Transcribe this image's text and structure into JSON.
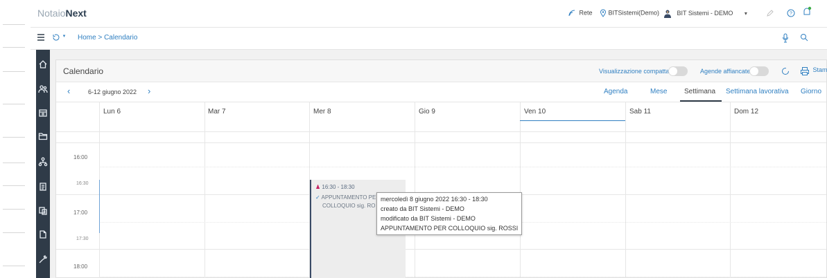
{
  "app": {
    "logo_prefix": "Notaio",
    "logo_suffix": "Next"
  },
  "topbar": {
    "network_label": "Rete",
    "location_label": "BITSistemi(Demo)",
    "user_label": "BIT Sistemi - DEMO"
  },
  "breadcrumb": {
    "text": "Home > Calendario"
  },
  "calendar": {
    "title": "Calendario",
    "compact_label": "Visualizzazione compatta",
    "side_by_side_label": "Agende affiancate",
    "print_label": "Stampa",
    "week_range": "6-12 giugno 2022",
    "views": [
      "Agenda",
      "Mese",
      "Settimana",
      "Settimana lavorativa",
      "Giorno"
    ],
    "active_view": "Settimana",
    "days": [
      "Lun 6",
      "Mar 7",
      "Mer 8",
      "Gio 9",
      "Ven 10",
      "Sab 11",
      "Dom 12"
    ],
    "times": [
      "16:00",
      "16:30",
      "17:00",
      "17:30",
      "18:00"
    ]
  },
  "event": {
    "time": "16:30 - 18:30",
    "title_line1": "APPUNTAMENTO PE",
    "title_line2": "COLLOQUIO sig. RO"
  },
  "tooltip": {
    "line1": "mercoledì 8 giugno 2022 16:30 - 18:30",
    "line2": "creato da BIT Sistemi - DEMO",
    "line3": "modificato da BIT Sistemi - DEMO",
    "line4": "APPUNTAMENTO PER COLLOQUIO sig. ROSSI"
  },
  "colors": {
    "sidebar": "#2f3b48",
    "accent": "#2f7fc1",
    "event_bg": "#ededed"
  }
}
